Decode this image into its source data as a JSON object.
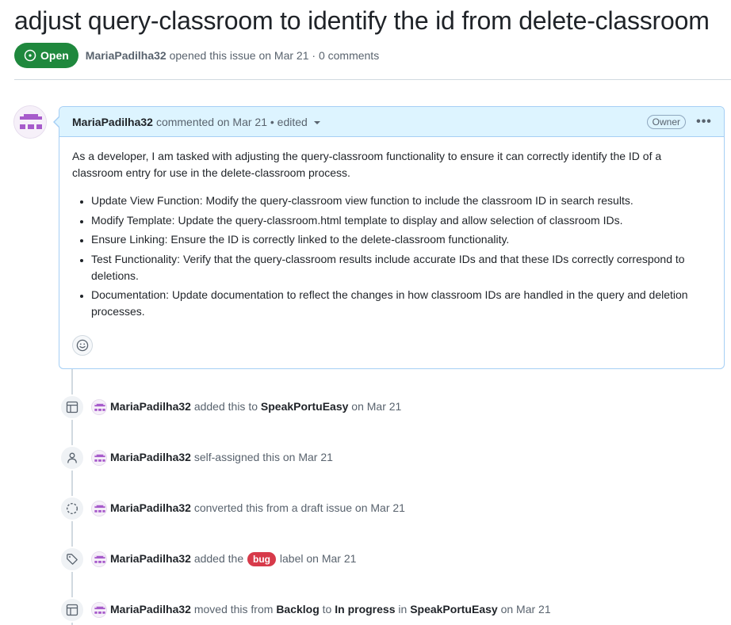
{
  "issue": {
    "title": "adjust query-classroom to identify the id from delete-classroom",
    "state": "Open",
    "author": "MariaPadilha32",
    "opened_text": "opened this issue on Mar 21 · 0 comments"
  },
  "comment": {
    "author": "MariaPadilha32",
    "meta": "commented on Mar 21 • edited",
    "role_badge": "Owner",
    "menu_label": "•••",
    "intro": "As a developer, I am tasked with adjusting the query-classroom functionality to ensure it can correctly identify the ID of a classroom entry for use in the delete-classroom process.",
    "items": [
      "Update View Function: Modify the query-classroom view function to include the classroom ID in search results.",
      "Modify Template: Update the query-classroom.html template to display and allow selection of classroom IDs.",
      "Ensure Linking: Ensure the ID is correctly linked to the delete-classroom functionality.",
      "Test Functionality: Verify that the query-classroom results include accurate IDs and that these IDs correctly correspond to deletions.",
      "Documentation: Update documentation to reflect the changes in how classroom IDs are handled in the query and deletion processes."
    ]
  },
  "events": [
    {
      "icon": "project-table-icon",
      "actor": "MariaPadilha32",
      "pre": "added this to",
      "project": "SpeakPortuEasy",
      "post": "on Mar 21"
    },
    {
      "icon": "person-icon",
      "actor": "MariaPadilha32",
      "pre": "self-assigned this on Mar 21"
    },
    {
      "icon": "draft-circle-icon",
      "actor": "MariaPadilha32",
      "pre": "converted this from a draft issue on Mar 21"
    },
    {
      "icon": "tag-icon",
      "actor": "MariaPadilha32",
      "pre": "added the",
      "label": "bug",
      "post": "label on Mar 21"
    },
    {
      "icon": "project-table-icon",
      "actor": "MariaPadilha32",
      "pre": "moved this from",
      "from": "Backlog",
      "to_word": "to",
      "to": "In progress",
      "in_word": "in",
      "project": "SpeakPortuEasy",
      "post": "on Mar 21"
    }
  ],
  "colors": {
    "open_green": "#1f883d",
    "comment_header_bg": "#ddf4ff",
    "bug_label": "#d73a4a",
    "avatar_purple": "#a75bcb"
  }
}
